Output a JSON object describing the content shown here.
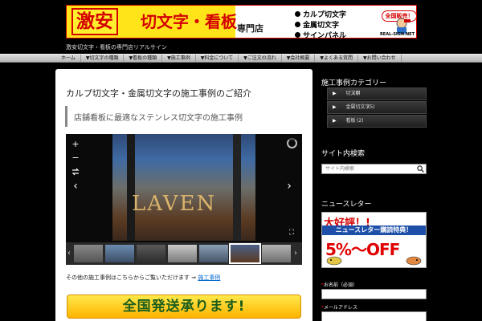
{
  "banner": {
    "gekiyasu": "激安",
    "main_text": "切文字・看板",
    "senmonten": "専門店",
    "bullets": [
      "カルプ切文字",
      "金属切文字",
      "サインパネル"
    ],
    "badge": "全国販売！",
    "site": "REAL-SIGN.NET"
  },
  "subtitle": "激安切文字・看板の専門店リアルサイン",
  "nav": {
    "items": [
      "ホーム",
      "▼切文字の種類",
      "▼看板の種類",
      "▼施工事例",
      "▼料金について",
      "▼ご注文の流れ",
      "▼会社概要",
      "▼よくある質問",
      "▼お問い合わせ"
    ]
  },
  "main": {
    "title": "カルプ切文字・金属切文字の施工事例のご紹介",
    "quote": "店舗看板に最適なステンレス切文字の施工事例",
    "slider": {
      "zoom_in": "+",
      "zoom_out": "−",
      "fullscreen": "⛶",
      "prev": "‹",
      "next": "›",
      "sign_text": "LAVEN"
    },
    "caption_prefix": "その他の施工事例はこちらからご覧いただけます ⇒",
    "caption_link": "施工事例",
    "cta": "全国発送承ります!"
  },
  "sidebar": {
    "category_heading": "施工事例カテゴリー",
    "categories": [
      {
        "label": "切文字",
        "count": "(6)"
      },
      {
        "label": "金属切文字",
        "count": "(5)"
      },
      {
        "label": "看板",
        "count": "(2)"
      }
    ],
    "search_heading": "サイト内検索",
    "search_placeholder": "サイト内検索",
    "newsletter_heading": "ニュースレター",
    "nl_banner": {
      "line1": "大好評！!",
      "line2": "ニュースレター購読特典！",
      "line3": "5%～OFF"
    },
    "form": {
      "name_label": "お名前（必須）",
      "email_label": "メールアドレス",
      "required_mark": "*"
    }
  }
}
